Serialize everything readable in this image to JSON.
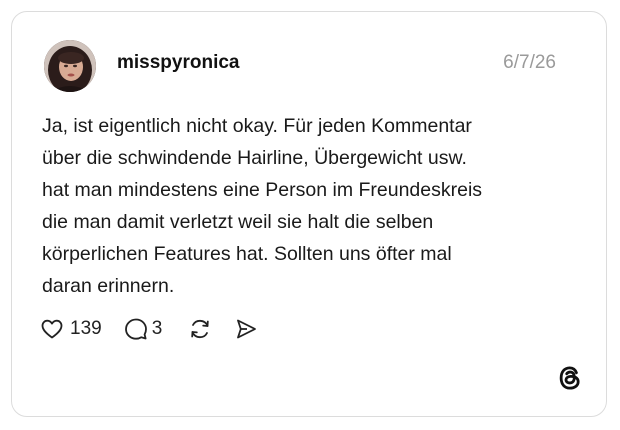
{
  "post": {
    "username": "misspyronica",
    "date": "6/7/26",
    "text_lines": [
      "Ja, ist eigentlich nicht okay. Für jeden Kommentar",
      "über die schwindende Hairline, Übergewicht usw.",
      "hat man mindestens eine Person im Freundeskreis",
      "die man damit verletzt weil sie halt die selben",
      "körperlichen Features hat. Sollten uns öfter mal",
      "daran erinnern."
    ],
    "likes": "139",
    "comments": "3"
  },
  "icons": {
    "like": "heart-icon",
    "comment": "speech-bubble-icon",
    "repost": "repost-icon",
    "share": "send-icon",
    "brand": "threads-logo-icon"
  },
  "colors": {
    "text": "#1a1a1a",
    "muted": "#9a9a9a",
    "border": "#dcdcdc"
  }
}
